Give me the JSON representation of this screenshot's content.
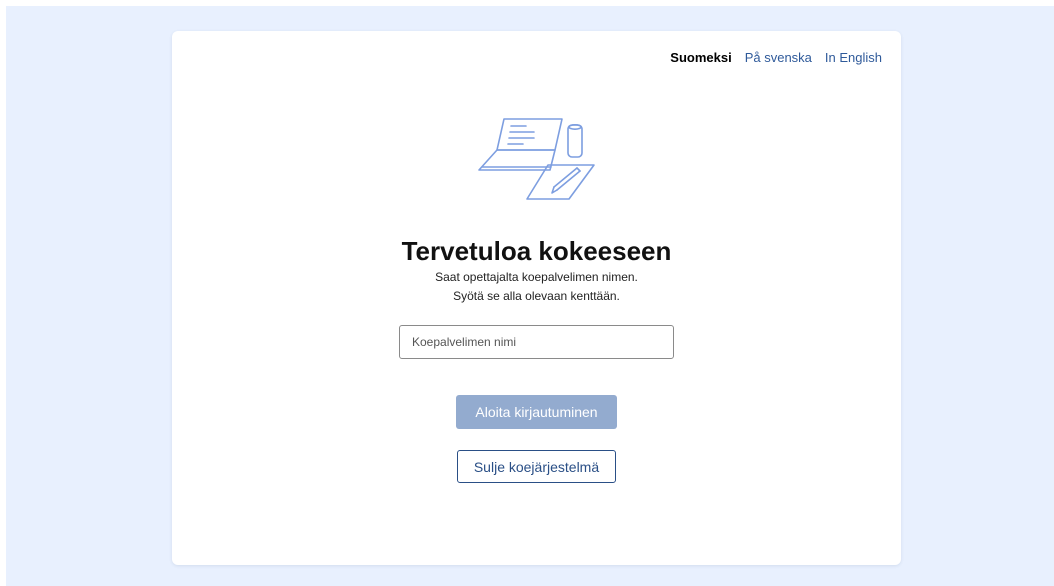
{
  "languages": [
    {
      "label": "Suomeksi",
      "active": true
    },
    {
      "label": "På svenska",
      "active": false
    },
    {
      "label": "In English",
      "active": false
    }
  ],
  "illustration": {
    "icon": "laptop-exam-icon",
    "color": "#7d9ee0"
  },
  "title": "Tervetuloa kokeeseen",
  "instructions": {
    "line1": "Saat opettajalta koepalvelimen nimen.",
    "line2": "Syötä se alla olevaan kenttään."
  },
  "server_input": {
    "value": "",
    "placeholder": "Koepalvelimen nimi"
  },
  "buttons": {
    "start_login": "Aloita kirjautuminen",
    "close_system": "Sulje koejärjestelmä"
  },
  "colors": {
    "background": "#e8f0fe",
    "primary_disabled": "#93abcf",
    "link": "#2f5a9a",
    "secondary_border": "#2a4f86"
  }
}
